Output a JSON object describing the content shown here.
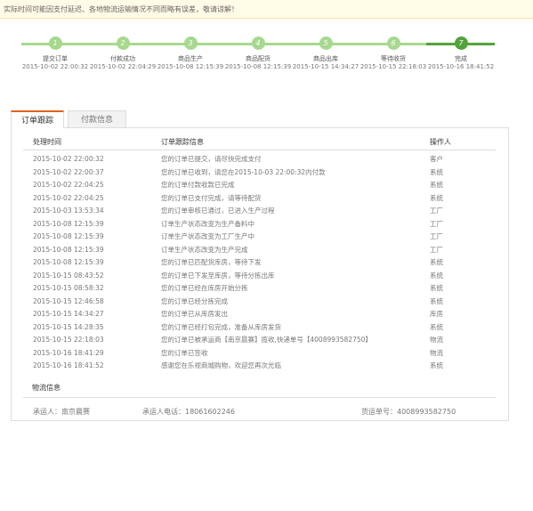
{
  "notice": "实际时间可能因支付延迟、各地物流运输情况不同而略有误差，敬请谅解！",
  "steps": [
    {
      "num": "1",
      "name": "提交订单",
      "time": "2015-10-02 22:00:32"
    },
    {
      "num": "2",
      "name": "付款成功",
      "time": "2015-10-02 22:04:29"
    },
    {
      "num": "3",
      "name": "商品生产",
      "time": "2015-10-08 12:15:39"
    },
    {
      "num": "4",
      "name": "商品配货",
      "time": "2015-10-08 12:15:39"
    },
    {
      "num": "5",
      "name": "商品出库",
      "time": "2015-10-15 14:34:27"
    },
    {
      "num": "6",
      "name": "等待收货",
      "time": "2015-10-15 22:18:03"
    },
    {
      "num": "7",
      "name": "完成",
      "time": "2015-10-16 18:41:52"
    }
  ],
  "tabs": {
    "tracking": "订单跟踪",
    "payment": "付款信息"
  },
  "table": {
    "headers": {
      "time": "处理时间",
      "info": "订单跟踪信息",
      "operator": "操作人"
    },
    "rows": [
      {
        "time": "2015-10-02 22:00:32",
        "info": "您的订单已提交，请尽快完成支付",
        "op": "客户"
      },
      {
        "time": "2015-10-02 22:00:37",
        "info": "您的订单已收到，请您在2015-10-03 22:00:32内付款",
        "op": "系统"
      },
      {
        "time": "2015-10-02 22:04:25",
        "info": "您的订单付款收款已完成",
        "op": "系统"
      },
      {
        "time": "2015-10-02 22:04:25",
        "info": "您的订单已支付完成，请等待配货",
        "op": "系统"
      },
      {
        "time": "2015-10-03 13:53:34",
        "info": "您的订单审核已通过，已进入生产过程",
        "op": "工厂"
      },
      {
        "time": "2015-10-08 12:15:39",
        "info": "订单生产状态改变为生产备料中",
        "op": "工厂"
      },
      {
        "time": "2015-10-08 12:15:39",
        "info": "订单生产状态改变为工厂生产中",
        "op": "工厂"
      },
      {
        "time": "2015-10-08 12:15:39",
        "info": "订单生产状态改变为生产完成",
        "op": "工厂"
      },
      {
        "time": "2015-10-08 12:15:39",
        "info": "您的订单已匹配货库房，等待下发",
        "op": "系统"
      },
      {
        "time": "2015-10-15 08:43:52",
        "info": "您的订单已下发至库房，等待分拣出库",
        "op": "系统"
      },
      {
        "time": "2015-10-15 08:58:32",
        "info": "您的订单已经在库房开始分拣",
        "op": "系统"
      },
      {
        "time": "2015-10-15 12:46:58",
        "info": "您的订单已经分拣完成",
        "op": "系统"
      },
      {
        "time": "2015-10-15 14:34:27",
        "info": "您的订单已从库房发出",
        "op": "库房"
      },
      {
        "time": "2015-10-15 14:28:35",
        "info": "您的订单已经打包完成，准备从库房发货",
        "op": "系统"
      },
      {
        "time": "2015-10-15 22:18:03",
        "info": "您的订单已被承运商【南京晨赛】揽收,快递单号【4008993582750】",
        "op": "物流"
      },
      {
        "time": "2015-10-16 18:41:29",
        "info": "您的订单已签收",
        "op": "物流"
      },
      {
        "time": "2015-10-16 18:41:52",
        "info": "感谢您在乐视商城购物，欢迎您再次光临",
        "op": "系统"
      }
    ]
  },
  "logistics": {
    "title": "物流信息",
    "carrier": "承运人：南京晨赛",
    "phone": "承运人电话：18061602246",
    "tracking": "货运单号：4008993582750"
  },
  "colors": {
    "accent": "#e2621f",
    "step_light": "#a6d98d",
    "step_done": "#52a43a"
  }
}
